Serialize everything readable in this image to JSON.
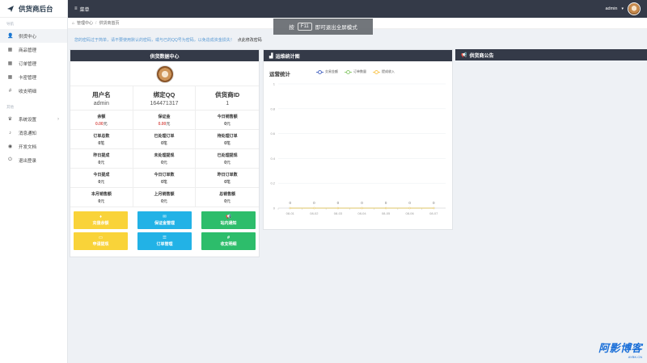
{
  "app": {
    "title": "供货商后台"
  },
  "sidebar": {
    "section1": "导航",
    "items1": [
      {
        "label": "供货中心",
        "icon": "user-icon",
        "glyph": "👤"
      },
      {
        "label": "商品管理",
        "icon": "grid-icon",
        "glyph": "▦"
      },
      {
        "label": "订单管理",
        "icon": "grid-icon",
        "glyph": "▦"
      },
      {
        "label": "卡密管理",
        "icon": "grid-icon",
        "glyph": "▦"
      },
      {
        "label": "收支明细",
        "icon": "hash-icon",
        "glyph": "#"
      }
    ],
    "section2": "其他",
    "items2": [
      {
        "label": "系统设置",
        "icon": "crown-icon",
        "glyph": "♛",
        "chevron": "›"
      },
      {
        "label": "消息通知",
        "icon": "bell-icon",
        "glyph": "♪"
      },
      {
        "label": "开发文档",
        "icon": "eye-icon",
        "glyph": "◉"
      },
      {
        "label": "退出登录",
        "icon": "power-icon",
        "glyph": "⏻"
      }
    ]
  },
  "topbar": {
    "menu_label": "菜单",
    "menu_glyph": "≡",
    "user": "admin",
    "caret": "▾"
  },
  "toast": {
    "prefix": "按",
    "key": "F11",
    "suffix": "即可退出全屏模式"
  },
  "breadcrumb": {
    "home": "管理中心",
    "sep": "/",
    "current": "供货商首页"
  },
  "notice": {
    "text": "您的密码过于简单，请不要使用默认的密码，或与已的QQ号为密码，以免造成资金损失！",
    "link": "点此修改密码"
  },
  "supply_panel": {
    "title": "供货数据中心",
    "info": [
      {
        "label": "用户名",
        "value": "admin"
      },
      {
        "label": "绑定QQ",
        "value": "164471317"
      },
      {
        "label": "供货商ID",
        "value": "1"
      }
    ],
    "stats": [
      {
        "label": "余额",
        "value": "0.00",
        "unit": "元",
        "red": true
      },
      {
        "label": "保证金",
        "value": "0.00",
        "unit": "元",
        "red": true
      },
      {
        "label": "今日销售额",
        "value": "0",
        "unit": "元"
      },
      {
        "label": "订单总数",
        "value": "0",
        "unit": "笔"
      },
      {
        "label": "已处理订单",
        "value": "0",
        "unit": "笔"
      },
      {
        "label": "待处理订单",
        "value": "0",
        "unit": "笔"
      },
      {
        "label": "昨日提成",
        "value": "0",
        "unit": "元"
      },
      {
        "label": "未处理提现",
        "value": "0",
        "unit": "元"
      },
      {
        "label": "已处理提现",
        "value": "0",
        "unit": "元"
      },
      {
        "label": "今日提成",
        "value": "0",
        "unit": "元"
      },
      {
        "label": "今日订单数",
        "value": "0",
        "unit": "笔"
      },
      {
        "label": "昨日订单数",
        "value": "0",
        "unit": "笔"
      },
      {
        "label": "本月销售额",
        "value": "0",
        "unit": "元"
      },
      {
        "label": "上月销售额",
        "value": "0",
        "unit": "元"
      },
      {
        "label": "总销售额",
        "value": "0",
        "unit": "元"
      }
    ],
    "buttons": [
      {
        "label": "充值余额",
        "glyph": "♦",
        "color": "yellow"
      },
      {
        "label": "保证金管理",
        "glyph": "✉",
        "color": "blue"
      },
      {
        "label": "站内通知",
        "glyph": "📢",
        "color": "green"
      },
      {
        "label": "申请提现",
        "glyph": "▭",
        "color": "yellow"
      },
      {
        "label": "订单管理",
        "glyph": "☰",
        "color": "blue"
      },
      {
        "label": "收支明细",
        "glyph": "#",
        "color": "green"
      }
    ]
  },
  "chart_panel": {
    "title": "运维统计图",
    "icon": "chart-icon",
    "glyph": "▟"
  },
  "notice_panel": {
    "title": "供货商公告",
    "icon": "megaphone-icon",
    "glyph": "📢"
  },
  "chart_data": {
    "type": "line",
    "title": "运营统计",
    "categories": [
      "08-01",
      "08-02",
      "08-03",
      "08-04",
      "08-05",
      "08-06",
      "08-07"
    ],
    "series": [
      {
        "name": "交易金额",
        "values": [
          0,
          0,
          0,
          0,
          0,
          0,
          0
        ],
        "color": "#5470c6"
      },
      {
        "name": "订单数量",
        "values": [
          0,
          0,
          0,
          0,
          0,
          0,
          0
        ],
        "color": "#91cc75"
      },
      {
        "name": "提成收入",
        "values": [
          0,
          0,
          0,
          0,
          0,
          0,
          0
        ],
        "color": "#fac858"
      }
    ],
    "yticks": [
      "0",
      "0.2",
      "0.4",
      "0.6",
      "0.8",
      "1"
    ],
    "ylim": [
      0,
      1
    ],
    "grid": true,
    "legend": "top"
  },
  "watermark": {
    "line1": "阿影博客",
    "line2": "AYBK.CN"
  }
}
